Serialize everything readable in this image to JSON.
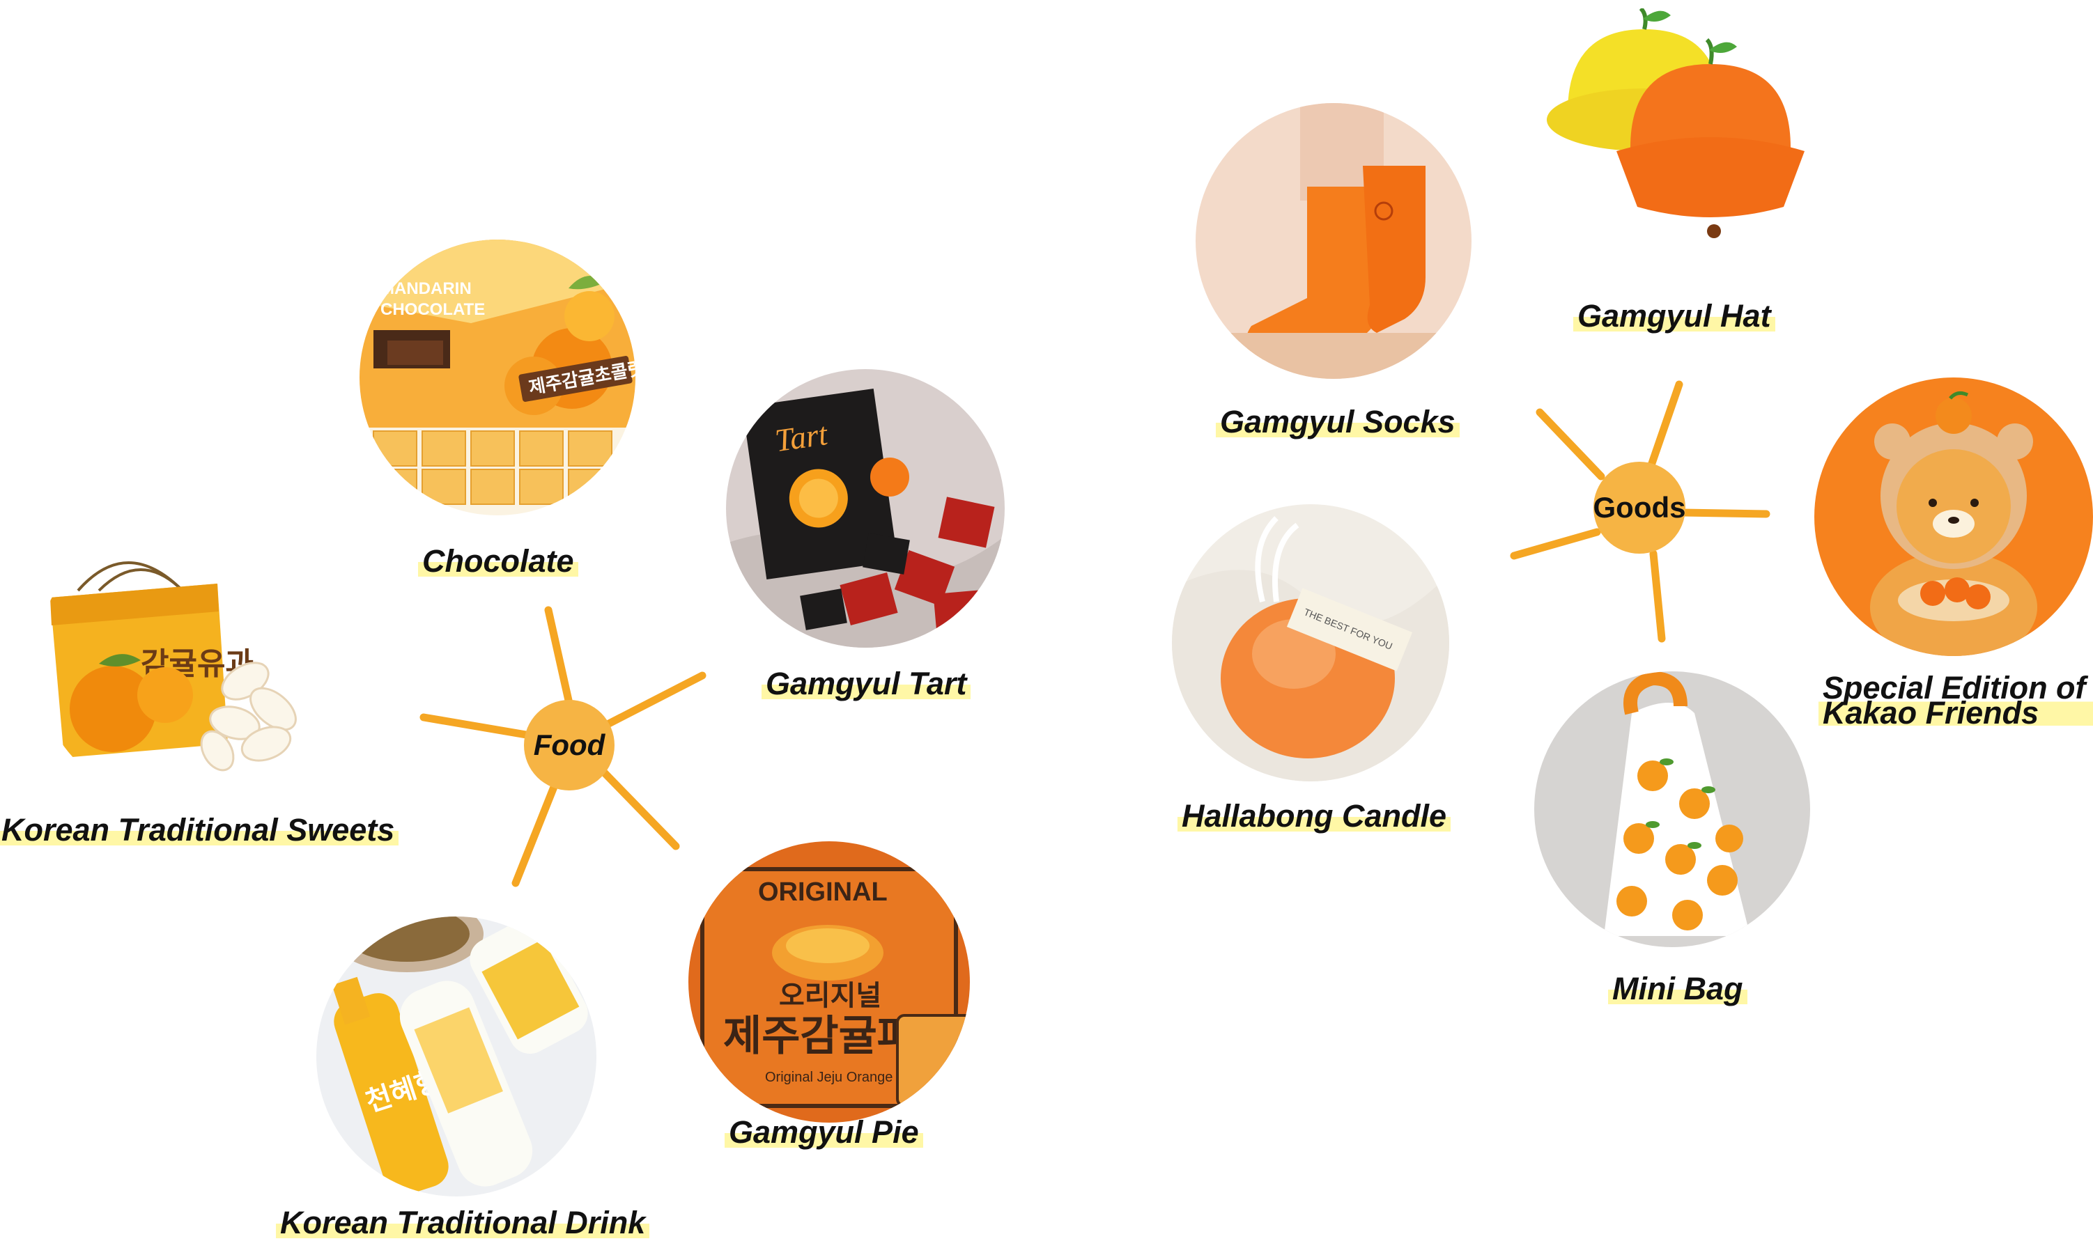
{
  "hubs": {
    "food": {
      "label": "Food",
      "color": "#f6b444"
    },
    "goods": {
      "label": "Goods",
      "color": "#f6b444"
    }
  },
  "food_items": {
    "chocolate": {
      "label": "Chocolate",
      "image": "mandarin-chocolate-box-photo",
      "package_line1": "MANDARIN",
      "package_line2": "CHOCOLATE",
      "package_korean": "제주감귤초콜릿"
    },
    "tart": {
      "label": "Gamgyul Tart",
      "image": "tart-box-photo",
      "package_text": "Tart"
    },
    "sweets": {
      "label": "Korean Traditional Sweets",
      "image": "yugwa-gift-box-photo",
      "package_korean": "감귤유과"
    },
    "drink": {
      "label": "Korean Traditional Drink",
      "image": "citrus-makgeolli-bottles-photo",
      "bottle_korean": "천혜향"
    },
    "pie": {
      "label": "Gamgyul Pie",
      "image": "orange-pie-package-photo",
      "package_line1": "ORIGINAL",
      "package_korean_top": "오리지널",
      "package_korean_main": "제주감귤파이",
      "package_english": "Original Jeju Orange"
    }
  },
  "goods_items": {
    "socks": {
      "label": "Gamgyul Socks",
      "image": "orange-socks-photo"
    },
    "hat": {
      "label": "Gamgyul Hat",
      "image": "tangerine-bucket-hats-photo"
    },
    "candle": {
      "label": "Hallabong Candle",
      "image": "hallabong-candle-photo",
      "tag_text": "THE BEST FOR YOU"
    },
    "kakao": {
      "label": "Special Edition of Kakao Friends",
      "image": "ryan-plush-photo"
    },
    "bag": {
      "label": "Mini Bag",
      "image": "orange-print-bag-photo"
    }
  },
  "colors": {
    "ray": "#f5a623",
    "hub": "#f6b444",
    "highlight": "#fff7a6",
    "orange": "#f27a1a",
    "yellow": "#f5d63a"
  }
}
